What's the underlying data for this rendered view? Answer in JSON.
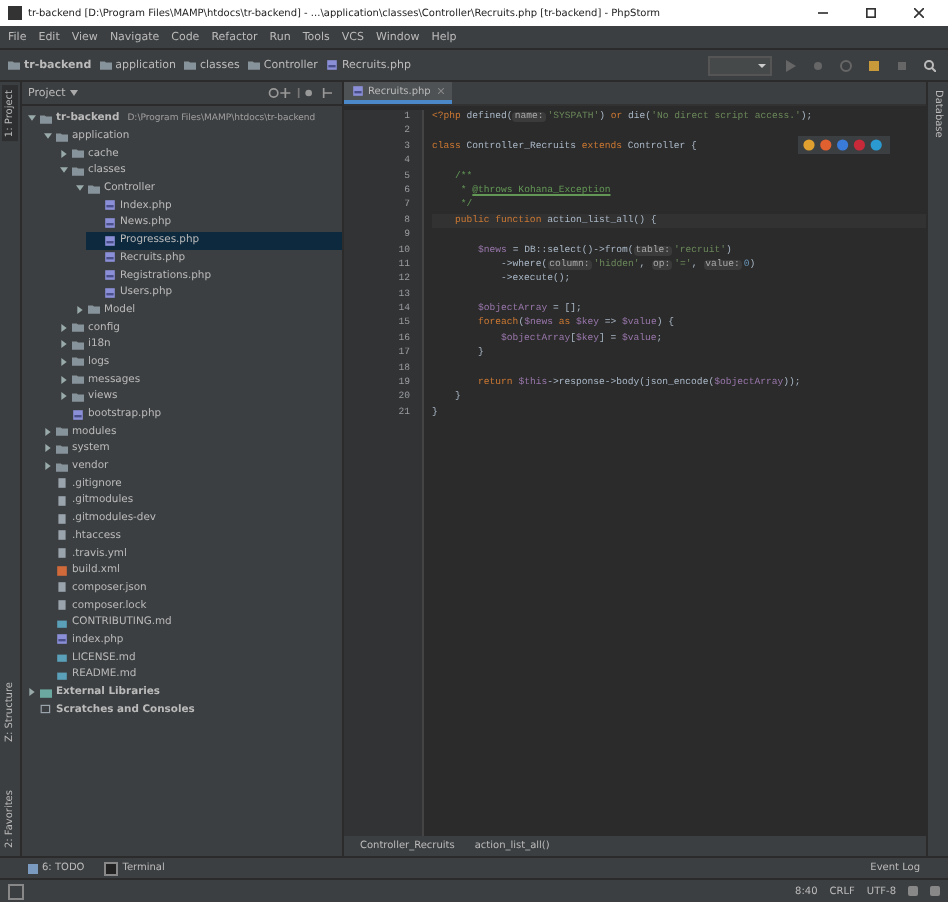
{
  "window": {
    "title": "tr-backend [D:\\Program Files\\MAMP\\htdocs\\tr-backend] - ...\\application\\classes\\Controller\\Recruits.php [tr-backend] - PhpStorm"
  },
  "menu": [
    "File",
    "Edit",
    "View",
    "Navigate",
    "Code",
    "Refactor",
    "Run",
    "Tools",
    "VCS",
    "Window",
    "Help"
  ],
  "navigation_bar": [
    {
      "label": "tr-backend",
      "kind": "folder"
    },
    {
      "label": "application",
      "kind": "folder"
    },
    {
      "label": "classes",
      "kind": "folder"
    },
    {
      "label": "Controller",
      "kind": "folder"
    },
    {
      "label": "Recruits.php",
      "kind": "php"
    }
  ],
  "left_stripe": [
    {
      "label": "1: Project",
      "selected": true
    },
    {
      "label": "Z: Structure",
      "selected": false
    },
    {
      "label": "2: Favorites",
      "selected": false
    }
  ],
  "right_stripe": [
    {
      "label": "Database"
    }
  ],
  "project_panel": {
    "title": "Project",
    "tree": [
      {
        "label": "tr-backend",
        "path": "D:\\Program Files\\MAMP\\htdocs\\tr-backend",
        "kind": "folder",
        "expanded": true,
        "selected": false,
        "children": [
          {
            "label": "application",
            "kind": "folder",
            "expanded": true,
            "selected": false,
            "children": [
              {
                "label": "cache",
                "kind": "folder",
                "expanded": false,
                "selected": false
              },
              {
                "label": "classes",
                "kind": "folder",
                "expanded": true,
                "selected": false,
                "children": [
                  {
                    "label": "Controller",
                    "kind": "folder",
                    "expanded": true,
                    "selected": false,
                    "children": [
                      {
                        "label": "Index.php",
                        "kind": "php",
                        "selected": false
                      },
                      {
                        "label": "News.php",
                        "kind": "php",
                        "selected": false
                      },
                      {
                        "label": "Progresses.php",
                        "kind": "php",
                        "selected": true
                      },
                      {
                        "label": "Recruits.php",
                        "kind": "php",
                        "selected": false
                      },
                      {
                        "label": "Registrations.php",
                        "kind": "php",
                        "selected": false
                      },
                      {
                        "label": "Users.php",
                        "kind": "php",
                        "selected": false
                      }
                    ]
                  },
                  {
                    "label": "Model",
                    "kind": "folder",
                    "expanded": false,
                    "selected": false
                  }
                ]
              },
              {
                "label": "config",
                "kind": "folder",
                "expanded": false,
                "selected": false
              },
              {
                "label": "i18n",
                "kind": "folder",
                "expanded": false,
                "selected": false
              },
              {
                "label": "logs",
                "kind": "folder",
                "expanded": false,
                "selected": false
              },
              {
                "label": "messages",
                "kind": "folder",
                "expanded": false,
                "selected": false
              },
              {
                "label": "views",
                "kind": "folder",
                "expanded": false,
                "selected": false
              },
              {
                "label": "bootstrap.php",
                "kind": "php",
                "selected": false
              }
            ]
          },
          {
            "label": "modules",
            "kind": "folder",
            "expanded": false,
            "selected": false
          },
          {
            "label": "system",
            "kind": "folder",
            "expanded": false,
            "selected": false
          },
          {
            "label": "vendor",
            "kind": "folder",
            "expanded": false,
            "selected": false
          },
          {
            "label": ".gitignore",
            "kind": "file",
            "selected": false
          },
          {
            "label": ".gitmodules",
            "kind": "file",
            "selected": false
          },
          {
            "label": ".gitmodules-dev",
            "kind": "file",
            "selected": false
          },
          {
            "label": ".htaccess",
            "kind": "file",
            "selected": false
          },
          {
            "label": ".travis.yml",
            "kind": "file",
            "selected": false
          },
          {
            "label": "build.xml",
            "kind": "xml",
            "selected": false
          },
          {
            "label": "composer.json",
            "kind": "file",
            "selected": false
          },
          {
            "label": "composer.lock",
            "kind": "file",
            "selected": false
          },
          {
            "label": "CONTRIBUTING.md",
            "kind": "md",
            "selected": false
          },
          {
            "label": "index.php",
            "kind": "php",
            "selected": false
          },
          {
            "label": "LICENSE.md",
            "kind": "md",
            "selected": false
          },
          {
            "label": "README.md",
            "kind": "md",
            "selected": false
          }
        ]
      },
      {
        "label": "External Libraries",
        "kind": "library",
        "expanded": false,
        "selected": false
      },
      {
        "label": "Scratches and Consoles",
        "kind": "scratch",
        "selected": false
      }
    ]
  },
  "editor": {
    "tabs": [
      {
        "label": "Recruits.php",
        "selected": true
      }
    ],
    "lines": [
      {
        "number": "1",
        "tokens": [
          {
            "kind": "kw",
            "t": "<?php "
          },
          {
            "kind": "fn",
            "t": "defined("
          },
          {
            "kind": "hint",
            "t": "name:"
          },
          {
            "kind": "str",
            "t": "'SYSPATH'"
          },
          {
            "kind": "fn",
            "t": ") "
          },
          {
            "kind": "kw",
            "t": "or "
          },
          {
            "kind": "fn",
            "t": "die("
          },
          {
            "kind": "str",
            "t": "'No direct script access.'"
          },
          {
            "kind": "fn",
            "t": ");"
          }
        ]
      },
      {
        "number": "2"
      },
      {
        "number": "3",
        "tokens": [
          {
            "kind": "kw",
            "t": "class "
          },
          {
            "kind": "fn",
            "t": "Controller_Recruits "
          },
          {
            "kind": "kw",
            "t": "extends "
          },
          {
            "kind": "fn",
            "t": "Controller {"
          }
        ]
      },
      {
        "number": "4"
      },
      {
        "number": "5",
        "tokens": [
          {
            "kind": "doc",
            "t": "    /**"
          }
        ]
      },
      {
        "number": "6",
        "tokens": [
          {
            "kind": "doc",
            "t": "     * "
          },
          {
            "kind": "tag",
            "t": "@throws Kohana_Exception"
          }
        ]
      },
      {
        "number": "7",
        "tokens": [
          {
            "kind": "doc",
            "t": "     */"
          }
        ]
      },
      {
        "number": "8",
        "tokens": [
          {
            "kind": "kw",
            "t": "    public function "
          },
          {
            "kind": "fn",
            "t": "action_list_all() {"
          }
        ]
      },
      {
        "number": "9"
      },
      {
        "number": "10",
        "tokens": [
          {
            "kind": "var",
            "t": "        $news "
          },
          {
            "kind": "fn",
            "t": "= DB::select()->from("
          },
          {
            "kind": "hint",
            "t": "table:"
          },
          {
            "kind": "str",
            "t": "'recruit'"
          },
          {
            "kind": "fn",
            "t": ")"
          }
        ]
      },
      {
        "number": "11",
        "tokens": [
          {
            "kind": "fn",
            "t": "            ->where("
          },
          {
            "kind": "hint",
            "t": "column:"
          },
          {
            "kind": "str",
            "t": "'hidden'"
          },
          {
            "kind": "fn",
            "t": ", "
          },
          {
            "kind": "hint",
            "t": "op:"
          },
          {
            "kind": "str",
            "t": "'='"
          },
          {
            "kind": "fn",
            "t": ", "
          },
          {
            "kind": "hint",
            "t": "value:"
          },
          {
            "kind": "num",
            "t": "0"
          },
          {
            "kind": "fn",
            "t": ")"
          }
        ]
      },
      {
        "number": "12",
        "tokens": [
          {
            "kind": "fn",
            "t": "            ->execute();"
          }
        ]
      },
      {
        "number": "13"
      },
      {
        "number": "14",
        "tokens": [
          {
            "kind": "var",
            "t": "        $objectArray "
          },
          {
            "kind": "fn",
            "t": "= [];"
          }
        ]
      },
      {
        "number": "15",
        "tokens": [
          {
            "kind": "kw",
            "t": "        foreach"
          },
          {
            "kind": "fn",
            "t": "("
          },
          {
            "kind": "var",
            "t": "$news "
          },
          {
            "kind": "kw",
            "t": "as "
          },
          {
            "kind": "var",
            "t": "$key "
          },
          {
            "kind": "fn",
            "t": "=> "
          },
          {
            "kind": "var",
            "t": "$value"
          },
          {
            "kind": "fn",
            "t": ") {"
          }
        ]
      },
      {
        "number": "16",
        "tokens": [
          {
            "kind": "var",
            "t": "            $objectArray"
          },
          {
            "kind": "fn",
            "t": "["
          },
          {
            "kind": "var",
            "t": "$key"
          },
          {
            "kind": "fn",
            "t": "] = "
          },
          {
            "kind": "var",
            "t": "$value"
          },
          {
            "kind": "fn",
            "t": ";"
          }
        ]
      },
      {
        "number": "17",
        "tokens": [
          {
            "kind": "fn",
            "t": "        }"
          }
        ]
      },
      {
        "number": "18"
      },
      {
        "number": "19",
        "tokens": [
          {
            "kind": "kw",
            "t": "        return "
          },
          {
            "kind": "var",
            "t": "$this"
          },
          {
            "kind": "fn",
            "t": "->response->body(json_encode("
          },
          {
            "kind": "var",
            "t": "$objectArray"
          },
          {
            "kind": "fn",
            "t": "));"
          }
        ]
      },
      {
        "number": "20",
        "tokens": [
          {
            "kind": "fn",
            "t": "    }"
          }
        ]
      },
      {
        "number": "21",
        "tokens": [
          {
            "kind": "fn",
            "t": "}"
          }
        ]
      }
    ],
    "breadcrumbs": [
      "Controller_Recruits",
      "action_list_all()"
    ]
  },
  "bottom_tabs": [
    {
      "label": "6: TODO",
      "kind": "todo"
    },
    {
      "label": "Terminal",
      "kind": "terminal"
    }
  ],
  "event_log": "Event Log",
  "status_bar": [
    "8:40",
    "CRLF",
    "UTF-8"
  ]
}
